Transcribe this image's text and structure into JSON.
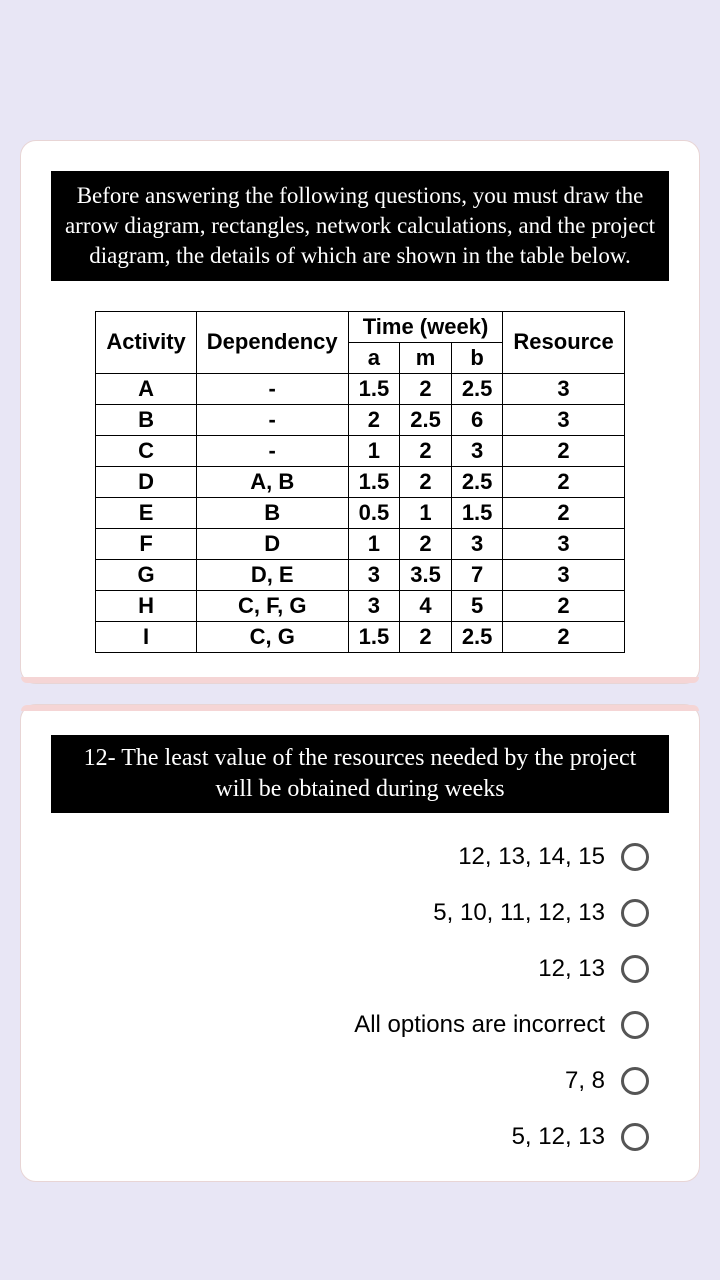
{
  "instruction": "Before answering the following questions, you must draw the arrow diagram, rectangles, network calculations, and the project diagram, the details of which are shown in the table below.",
  "table": {
    "headers": {
      "activity": "Activity",
      "dependency": "Dependency",
      "time_group": "Time (week)",
      "a": "a",
      "m": "m",
      "b": "b",
      "resource": "Resource"
    },
    "rows": [
      {
        "activity": "A",
        "dependency": "-",
        "a": "1.5",
        "m": "2",
        "b": "2.5",
        "resource": "3"
      },
      {
        "activity": "B",
        "dependency": "-",
        "a": "2",
        "m": "2.5",
        "b": "6",
        "resource": "3"
      },
      {
        "activity": "C",
        "dependency": "-",
        "a": "1",
        "m": "2",
        "b": "3",
        "resource": "2"
      },
      {
        "activity": "D",
        "dependency": "A, B",
        "a": "1.5",
        "m": "2",
        "b": "2.5",
        "resource": "2"
      },
      {
        "activity": "E",
        "dependency": "B",
        "a": "0.5",
        "m": "1",
        "b": "1.5",
        "resource": "2"
      },
      {
        "activity": "F",
        "dependency": "D",
        "a": "1",
        "m": "2",
        "b": "3",
        "resource": "3"
      },
      {
        "activity": "G",
        "dependency": "D, E",
        "a": "3",
        "m": "3.5",
        "b": "7",
        "resource": "3"
      },
      {
        "activity": "H",
        "dependency": "C, F, G",
        "a": "3",
        "m": "4",
        "b": "5",
        "resource": "2"
      },
      {
        "activity": "I",
        "dependency": "C, G",
        "a": "1.5",
        "m": "2",
        "b": "2.5",
        "resource": "2"
      }
    ]
  },
  "question": {
    "text": "12- The least value of the resources needed by the project will be obtained during weeks",
    "options": [
      "12, 13, 14, 15",
      "5, 10, 11, 12, 13",
      "12, 13",
      "All options are incorrect",
      "7, 8",
      "5, 12, 13"
    ]
  }
}
